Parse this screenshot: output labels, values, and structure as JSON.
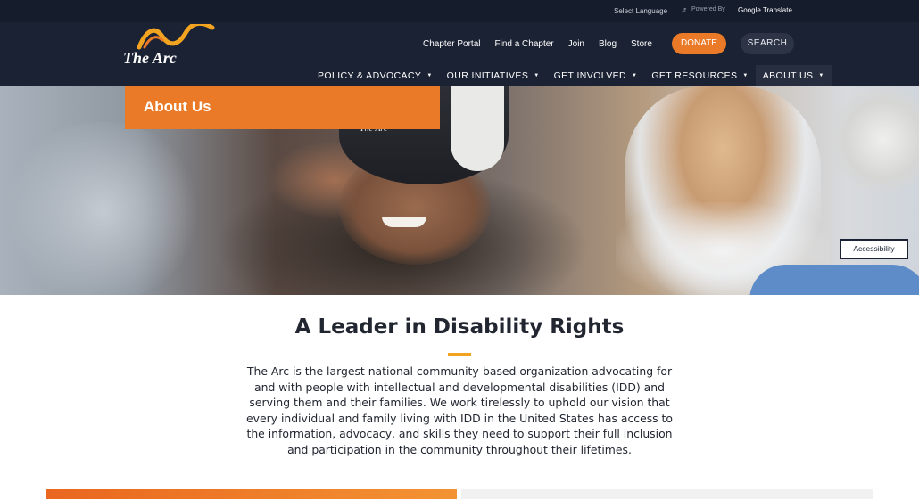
{
  "utility": {
    "select_language": "Select Language",
    "powered_by": "Powered By",
    "google_translate": "Google Translate"
  },
  "logo": {
    "text": "The Arc"
  },
  "top_links": [
    "Chapter Portal",
    "Find a Chapter",
    "Join",
    "Blog",
    "Store"
  ],
  "buttons": {
    "donate": "DONATE",
    "search": "SEARCH"
  },
  "main_nav": [
    {
      "label": "POLICY & ADVOCACY"
    },
    {
      "label": "OUR INITIATIVES"
    },
    {
      "label": "GET INVOLVED"
    },
    {
      "label": "GET RESOURCES"
    },
    {
      "label": "ABOUT US"
    }
  ],
  "hero": {
    "title": "About Us",
    "cap_logo": "The Arc"
  },
  "accessibility_label": "Accessibility",
  "content": {
    "title": "A Leader in Disability Rights",
    "body": "The Arc is the largest national community-based organization advocating for and with people with intellectual and developmental disabilities (IDD) and serving them and their families. We work tirelessly to uphold our vision that every individual and family living with IDD in the United States has access to the information, advocacy, and skills they need to support their full inclusion and participation in the community throughout their lifetimes."
  },
  "colors": {
    "brand_orange": "#ea7a27",
    "navy": "#1b2233",
    "accent_gold": "#f2a421"
  }
}
